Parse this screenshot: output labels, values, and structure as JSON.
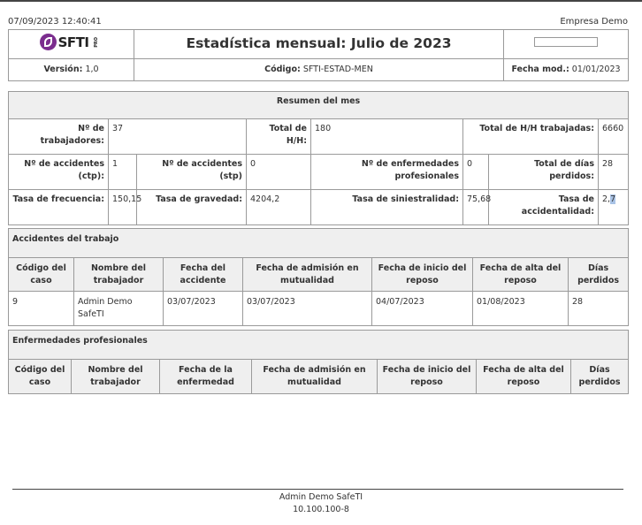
{
  "print_datetime": "07/09/2023 12:40:41",
  "company": "Empresa Demo",
  "header": {
    "logo_text": "SFTI",
    "logo_sub": "PRO",
    "title": "Estadística mensual: Julio de 2023",
    "version_label": "Versión:",
    "version_value": "1,0",
    "code_label": "Código:",
    "code_value": "SFTI-ESTAD-MEN",
    "date_label": "Fecha mod.:",
    "date_value": "01/01/2023"
  },
  "summary": {
    "title": "Resumen del mes",
    "workers_label": "Nº de trabajadores:",
    "workers_value": "37",
    "total_hh_label": "Total de H/H:",
    "total_hh_value": "180",
    "total_hh_worked_label": "Total de H/H trabajadas:",
    "total_hh_worked_value": "6660",
    "acc_ctp_label": "Nº de accidentes (ctp):",
    "acc_ctp_value": "1",
    "acc_stp_label": "Nº de accidentes (stp)",
    "acc_stp_value": "0",
    "diseases_label": "Nº de enfermedades profesionales",
    "diseases_value": "0",
    "lost_days_label": "Total de días perdidos:",
    "lost_days_value": "28",
    "freq_label": "Tasa de frecuencia:",
    "freq_value": "150,15",
    "grav_label": "Tasa de gravedad:",
    "grav_value": "4204,2",
    "sin_label": "Tasa de siniestralidad:",
    "sin_value": "75,68",
    "acc_rate_label": "Tasa de accidentalidad:",
    "acc_rate_value_a": "2,",
    "acc_rate_value_b": "7"
  },
  "accidents": {
    "title": "Accidentes del trabajo",
    "columns": [
      "Código del caso",
      "Nombre del trabajador",
      "Fecha del accidente",
      "Fecha de admisión en mutualidad",
      "Fecha de inicio del reposo",
      "Fecha de alta del reposo",
      "Días perdidos"
    ],
    "rows": [
      [
        "9",
        "Admin Demo SafeTI",
        "03/07/2023",
        "03/07/2023",
        "04/07/2023",
        "01/08/2023",
        "28"
      ]
    ]
  },
  "diseases": {
    "title": "Enfermedades profesionales",
    "columns": [
      "Código del caso",
      "Nombre del trabajador",
      "Fecha de la enfermedad",
      "Fecha de admisión en mutualidad",
      "Fecha de inicio del reposo",
      "Fecha de alta del reposo",
      "Días perdidos"
    ]
  },
  "footer": {
    "user": "Admin Demo SafeTI",
    "ip": "10.100.100-8"
  }
}
